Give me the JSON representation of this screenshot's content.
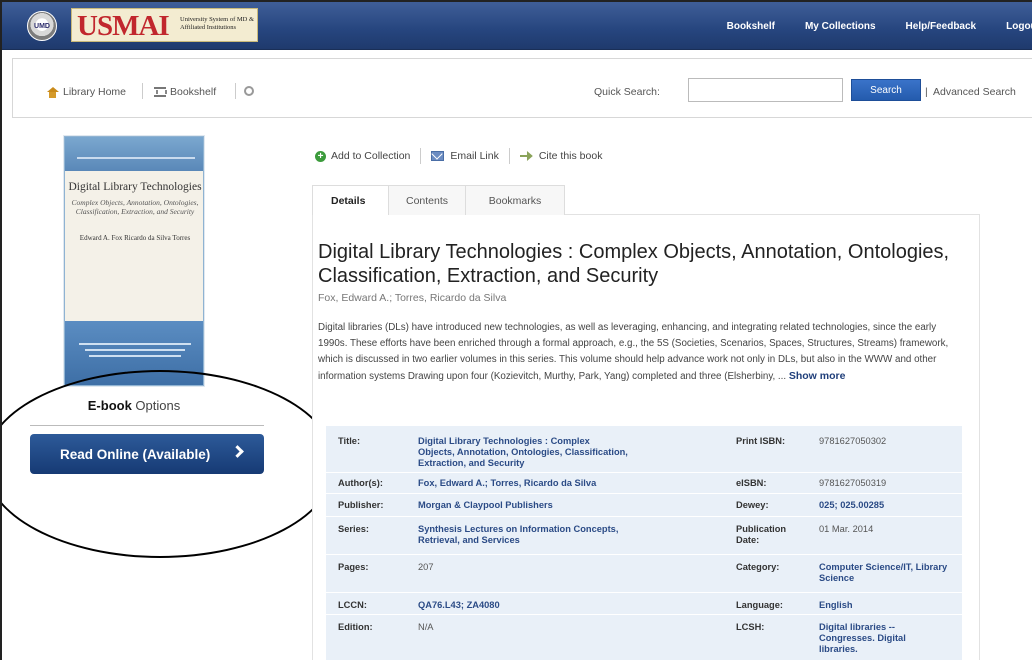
{
  "header": {
    "logo_text": "USMAI",
    "logo_subtitle": "University System of MD & Affiliated Institutions",
    "nav": [
      "Bookshelf",
      "My Collections",
      "Help/Feedback",
      "Logout"
    ]
  },
  "toolbar": {
    "library_home": "Library Home",
    "bookshelf": "Bookshelf",
    "quick_search_label": "Quick Search:",
    "search_value": "",
    "search_button": "Search",
    "advanced_search": "Advanced Search"
  },
  "cover": {
    "series_band": "SYNTHESIS LECTURES ON INFORMATION CONCEPTS",
    "title": "Digital Library Technologies",
    "subtitle": "Complex Objects, Annotation, Ontologies, Classification, Extraction, and Security",
    "authors": "Edward A. Fox Ricardo da Silva Torres"
  },
  "ebook": {
    "options_bold": "E-book",
    "options_rest": " Options",
    "read_online": "Read Online (Available)"
  },
  "actions": [
    "Add to Collection",
    "Email Link",
    "Cite this book"
  ],
  "tabs": [
    "Details",
    "Contents",
    "Bookmarks"
  ],
  "book": {
    "title": "Digital Library Technologies : Complex Objects, Annotation, Ontologies, Classification, Extraction, and Security",
    "authors": "Fox, Edward A.; Torres, Ricardo da Silva",
    "abstract": "Digital libraries (DLs) have introduced new technologies, as well as leveraging, enhancing, and integrating related technologies, since the early 1990s. These efforts have been enriched through a formal approach, e.g., the 5S (Societies, Scenarios, Spaces, Structures, Streams) framework, which is discussed in two earlier volumes in this series. This volume should help advance work not only in DLs, but also in the WWW and other information systems Drawing upon four (Kozievitch, Murthy, Park, Yang) completed and three (Elsherbiny, ...",
    "show_more": "Show more"
  },
  "details": {
    "left": [
      {
        "label": "Title:",
        "value": "Digital Library Technologies : Complex Objects, Annotation, Ontologies, Classification, Extraction, and Security"
      },
      {
        "label": "Author(s):",
        "value": "Fox, Edward A.; Torres, Ricardo da Silva"
      },
      {
        "label": "Publisher:",
        "value": "Morgan & Claypool Publishers"
      },
      {
        "label": "Series:",
        "value": "Synthesis Lectures on Information Concepts, Retrieval, and Services"
      },
      {
        "label": "Pages:",
        "value": "207"
      },
      {
        "label": "LCCN:",
        "value": "QA76.L43; ZA4080"
      },
      {
        "label": "Edition:",
        "value": "N/A"
      }
    ],
    "right": [
      {
        "label": "Print ISBN:",
        "value": "9781627050302"
      },
      {
        "label": "eISBN:",
        "value": "9781627050319"
      },
      {
        "label": "Dewey:",
        "value": "025; 025.00285"
      },
      {
        "label": "Publication Date:",
        "value": "01 Mar. 2014"
      },
      {
        "label": "Category:",
        "value": "Computer Science/IT, Library Science"
      },
      {
        "label": "Language:",
        "value": "English"
      },
      {
        "label": "LCSH:",
        "value": "Digital libraries -- Congresses. Digital libraries."
      }
    ]
  }
}
